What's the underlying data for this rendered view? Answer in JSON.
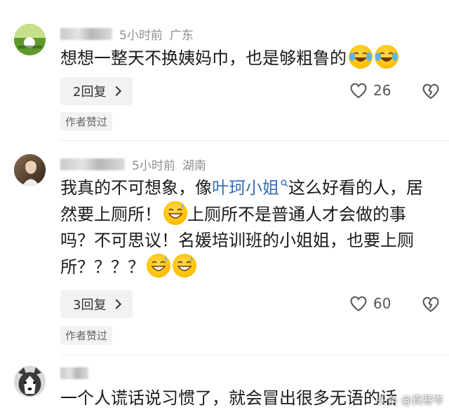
{
  "comments": [
    {
      "time": "5小时前",
      "location": "广东",
      "text": "想想一整天不换姨妈巾，也是够粗鲁的",
      "replies_label": "2回复",
      "likes": "26",
      "badge": "作者赞过"
    },
    {
      "time": "5小时前",
      "location": "湖南",
      "text_before": "我真的不可想象，像",
      "link_text": "叶珂小姐",
      "text_mid": "这么好看的人，居然要上厕所！",
      "text_mid2": "上厕所不是普通人才会做的事吗？不可思议！名媛培训班的小姐姐，也要上厕所？？？？",
      "replies_label": "3回复",
      "likes": "60",
      "badge": "作者赞过"
    },
    {
      "text": "一个人谎话说习惯了，就会冒出很多无语的话"
    }
  ],
  "watermark": "头条 @真寒岑",
  "icons": [
    "avatar-golf",
    "avatar-person",
    "avatar-husky",
    "heart-icon",
    "broken-heart-icon",
    "search-icon",
    "laugh-cry-emoji",
    "grin-sweat-emoji",
    "chevron-right-icon"
  ]
}
